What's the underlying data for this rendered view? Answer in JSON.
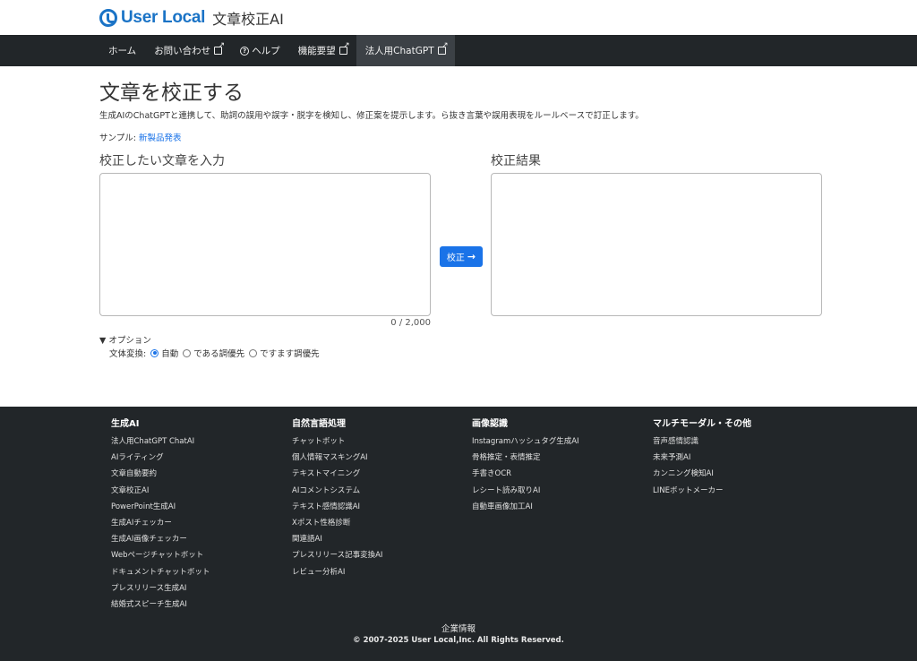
{
  "header": {
    "logo_text": "User Local",
    "app_title": "文章校正AI"
  },
  "nav": {
    "items": [
      {
        "label": "ホーム"
      },
      {
        "label": "お問い合わせ"
      },
      {
        "label": "ヘルプ"
      },
      {
        "label": "機能要望"
      },
      {
        "label": "法人用ChatGPT"
      }
    ]
  },
  "main": {
    "title": "文章を校正する",
    "description": "生成AIのChatGPTと連携して、助詞の誤用や誤字・脱字を検知し、修正案を提示します。ら抜き言葉や誤用表現をルールベースで訂正します。",
    "sample_prefix": "サンプル: ",
    "sample_link": "新製品発表",
    "input_label": "校正したい文章を入力",
    "input_value": "",
    "result_label": "校正結果",
    "counter": "0 / 2,000",
    "proof_button": "校正",
    "options_label": "▼ オプション",
    "style_label": "文体変換: ",
    "style_options": [
      {
        "label": "自動",
        "checked": true
      },
      {
        "label": "である調優先",
        "checked": false
      },
      {
        "label": "ですます調優先",
        "checked": false
      }
    ]
  },
  "footer": {
    "columns": [
      {
        "heading": "生成AI",
        "items": [
          "法人用ChatGPT ChatAI",
          "AIライティング",
          "文章自動要約",
          "文章校正AI",
          "PowerPoint生成AI",
          "生成AIチェッカー",
          "生成AI画像チェッカー",
          "Webページチャットボット",
          "ドキュメントチャットボット",
          "プレスリリース生成AI",
          "結婚式スピーチ生成AI"
        ]
      },
      {
        "heading": "自然言語処理",
        "items": [
          "チャットボット",
          "個人情報マスキングAI",
          "テキストマイニング",
          "AIコメントシステム",
          "テキスト感情認識AI",
          "Xポスト性格診断",
          "関連語AI",
          "プレスリリース記事変換AI",
          "レビュー分析AI"
        ]
      },
      {
        "heading": "画像認識",
        "items": [
          "Instagramハッシュタグ生成AI",
          "骨格推定・表情推定",
          "手書きOCR",
          "レシート読み取りAI",
          "自動車画像加工AI"
        ]
      },
      {
        "heading": "マルチモーダル・その他",
        "items": [
          "音声感情認識",
          "未来予測AI",
          "カンニング検知AI",
          "LINEボットメーカー"
        ]
      }
    ],
    "company": "企業情報",
    "copyright": "© 2007-2025 User Local,Inc. All Rights Reserved."
  }
}
